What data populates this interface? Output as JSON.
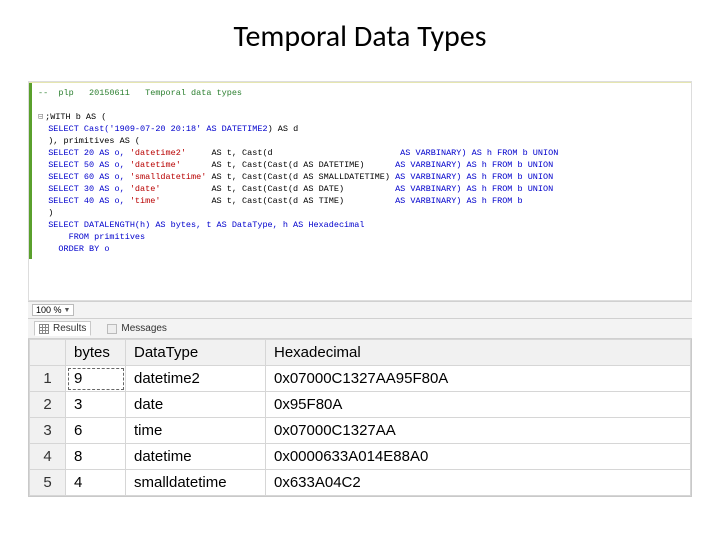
{
  "title": "Temporal Data Types",
  "code": {
    "comment1": "--  plp   20150611   Temporal data types",
    "line_with": ";WITH b AS (",
    "select1_a": "SELECT Cast('1909-07-20 20:18' ",
    "select1_kw": "AS DATETIME2",
    "select1_b": ") AS d",
    "line_close1": "), primitives AS (",
    "r1_a": "SELECT 20 AS o, ",
    "r1_lit": "'datetime2'",
    "r1_mid": "     AS t, Cast(d",
    "r1_end": "                         AS VARBINARY) AS h FROM b UNION",
    "r2_a": "SELECT 50 AS o, ",
    "r2_lit": "'datetime'",
    "r2_mid": "      AS t, Cast(Cast(d AS DATETIME)",
    "r2_end": "      AS VARBINARY) AS h FROM b UNION",
    "r3_a": "SELECT 60 AS o, ",
    "r3_lit": "'smalldatetime'",
    "r3_mid": " AS t, Cast(Cast(d AS SMALLDATETIME)",
    "r3_end": " AS VARBINARY) AS h FROM b UNION",
    "r4_a": "SELECT 30 AS o, ",
    "r4_lit": "'date'",
    "r4_mid": "          AS t, Cast(Cast(d AS DATE)",
    "r4_end": "          AS VARBINARY) AS h FROM b UNION",
    "r5_a": "SELECT 40 AS o, ",
    "r5_lit": "'time'",
    "r5_mid": "          AS t, Cast(Cast(d AS TIME)",
    "r5_end": "          AS VARBINARY) AS h FROM b",
    "line_close2": ")",
    "sel2": "SELECT DATALENGTH(h) AS bytes, t AS DataType, h AS Hexadecimal",
    "from": "  FROM primitives",
    "order": " ORDER BY o"
  },
  "status": {
    "zoom": "100 %",
    "dash": "▾"
  },
  "tabs": {
    "results": "Results",
    "messages": "Messages"
  },
  "columns": {
    "bytes": "bytes",
    "datatype": "DataType",
    "hex": "Hexadecimal"
  },
  "rows": [
    {
      "n": "1",
      "bytes": "9",
      "dt": "datetime2",
      "hex": "0x07000C1327AA95F80A"
    },
    {
      "n": "2",
      "bytes": "3",
      "dt": "date",
      "hex": "0x95F80A"
    },
    {
      "n": "3",
      "bytes": "6",
      "dt": "time",
      "hex": "0x07000C1327AA"
    },
    {
      "n": "4",
      "bytes": "8",
      "dt": "datetime",
      "hex": "0x0000633A014E88A0"
    },
    {
      "n": "5",
      "bytes": "4",
      "dt": "smalldatetime",
      "hex": "0x633A04C2"
    }
  ]
}
